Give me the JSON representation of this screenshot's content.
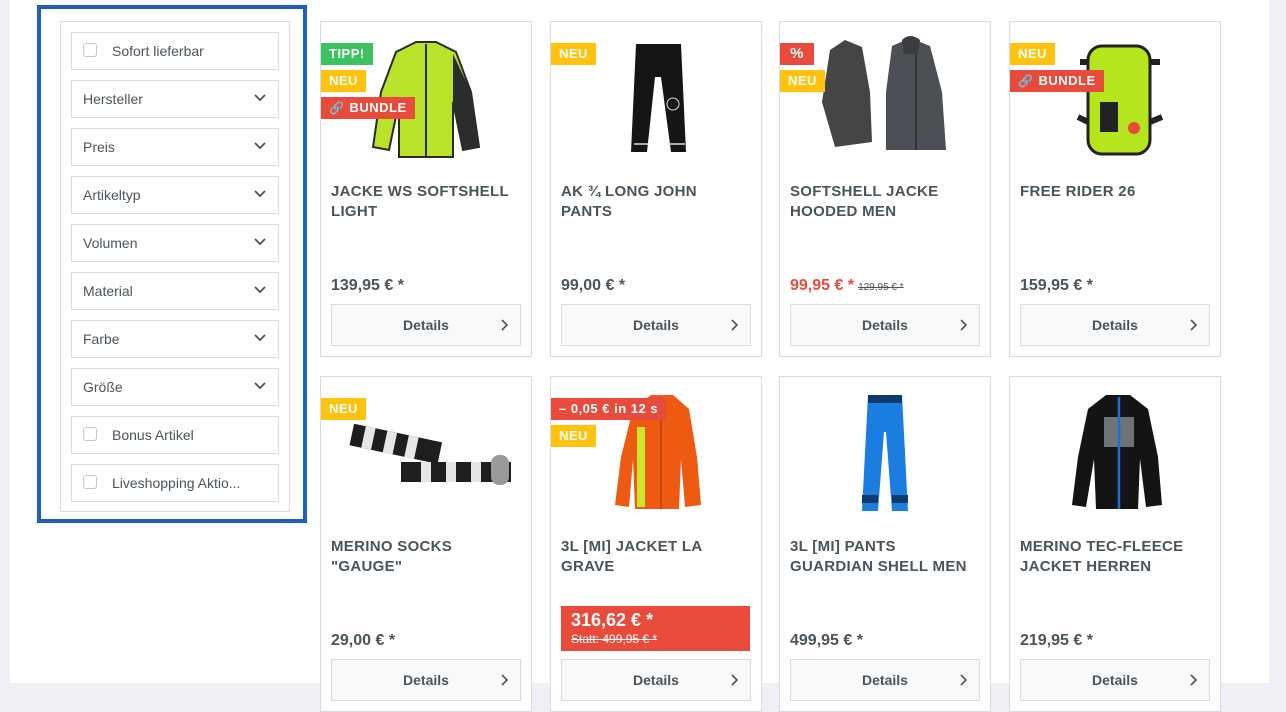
{
  "filters": [
    {
      "type": "check",
      "label": "Sofort lieferbar"
    },
    {
      "type": "dropdown",
      "label": "Hersteller"
    },
    {
      "type": "dropdown",
      "label": "Preis"
    },
    {
      "type": "dropdown",
      "label": "Artikeltyp"
    },
    {
      "type": "dropdown",
      "label": "Volumen"
    },
    {
      "type": "dropdown",
      "label": "Material"
    },
    {
      "type": "dropdown",
      "label": "Farbe"
    },
    {
      "type": "dropdown",
      "label": "Größe"
    },
    {
      "type": "check",
      "label": "Bonus Artikel"
    },
    {
      "type": "check",
      "label": "Liveshopping Aktio..."
    }
  ],
  "badges": {
    "tipp": "TIPP!",
    "neu": "NEU",
    "bundle": "BUNDLE",
    "percent": "%",
    "live": "– 0,05 € in 12 s"
  },
  "details_label": "Details",
  "products": [
    {
      "title": "JACKE WS SOFTSHELL LIGHT",
      "price": "139,95 € *",
      "badges": [
        "TIPP!",
        "NEU",
        "BUNDLE"
      ],
      "image": "jacket-lime"
    },
    {
      "title": "AK ¾ LONG JOHN PANTS",
      "price": "99,00 € *",
      "badges": [
        "NEU"
      ],
      "image": "long-johns-black"
    },
    {
      "title": "SOFTSHELL JACKE HOODED MEN",
      "price": "99,95 € *",
      "old_price": "129,95 € *",
      "badges": [
        "%",
        "NEU"
      ],
      "image": "hoodie-grey"
    },
    {
      "title": "FREE RIDER 26",
      "price": "159,95 € *",
      "badges": [
        "NEU",
        "BUNDLE"
      ],
      "image": "backpack-lime"
    },
    {
      "title": "MERINO SOCKS \"GAUGE\"",
      "price": "29,00 € *",
      "badges": [
        "NEU"
      ],
      "image": "socks-striped"
    },
    {
      "title": "3L [MI] JACKET LA GRAVE",
      "live_price": "316,62 € *",
      "live_old": "Statt: 499,95 € *",
      "badges": [
        "– 0,05 € in 12 s",
        "NEU"
      ],
      "image": "jacket-orange"
    },
    {
      "title": "3L [MI] PANTS GUARDIAN SHELL MEN",
      "price": "499,95 € *",
      "badges": [],
      "image": "pants-blue"
    },
    {
      "title": "MERINO TEC-FLEECE JACKET HERREN",
      "price": "219,95 € *",
      "badges": [],
      "image": "fleece-black"
    }
  ],
  "colors": {
    "accent_blue": "#1f5fbf",
    "sale_red": "#e84b3c",
    "neu_yellow": "#ffc20d",
    "tipp_green": "#3cc261"
  }
}
